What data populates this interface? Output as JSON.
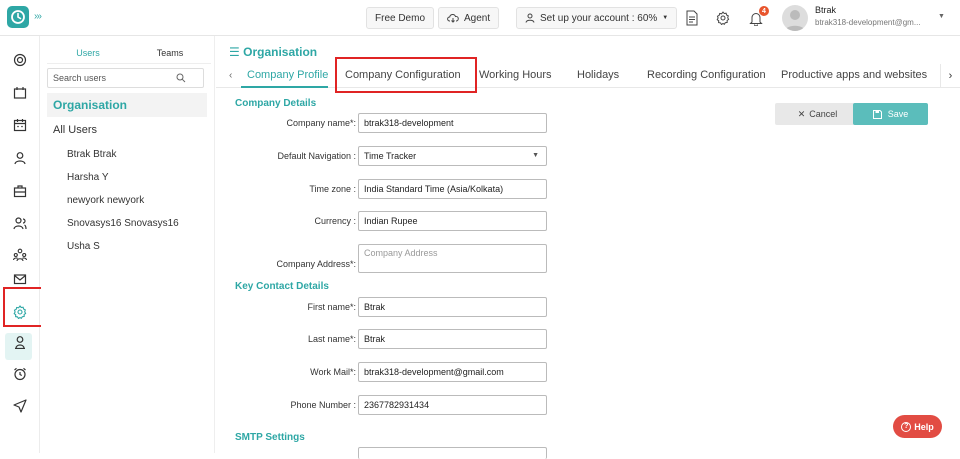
{
  "topbar": {
    "free_demo": "Free Demo",
    "agent": "Agent",
    "setup": "Set up your account : 60%",
    "notification_count": "4",
    "user_name": "Btrak",
    "user_email": "btrak318-development@gm..."
  },
  "people_panel": {
    "tabs": [
      "Users",
      "Teams"
    ],
    "search_placeholder": "Search users",
    "org_heading": "Organisation",
    "items": [
      "All Users",
      "Btrak Btrak",
      "Harsha Y",
      "newyork newyork",
      "Snovasys16 Snovasys16",
      "Usha S"
    ]
  },
  "main": {
    "title": "Organisation",
    "tabs": [
      "Company Profile",
      "Company Configuration",
      "Working Hours",
      "Holidays",
      "Recording Configuration",
      "Productive apps and websites"
    ],
    "active_tab": "Company Profile",
    "cancel_label": "Cancel",
    "save_label": "Save"
  },
  "company_details": {
    "heading": "Company Details",
    "company_name_label": "Company name*:",
    "company_name": "btrak318-development",
    "default_nav_label": "Default Navigation :",
    "default_nav": "Time Tracker",
    "timezone_label": "Time zone :",
    "timezone": "India Standard Time (Asia/Kolkata)",
    "currency_label": "Currency :",
    "currency": "Indian Rupee",
    "address_label": "Company Address*:",
    "address_placeholder": "Company Address"
  },
  "key_contact": {
    "heading": "Key Contact Details",
    "first_name_label": "First name*:",
    "first_name": "Btrak",
    "last_name_label": "Last name*:",
    "last_name": "Btrak",
    "work_mail_label": "Work Mail*:",
    "work_mail": "btrak318-development@gmail.com",
    "phone_label": "Phone Number :",
    "phone": "2367782931434"
  },
  "smtp": {
    "heading": "SMTP Settings"
  },
  "help": {
    "label": "Help"
  },
  "colors": {
    "accent": "#2ea7a5",
    "highlight_box": "#e02424",
    "help_button": "#e24c43"
  }
}
